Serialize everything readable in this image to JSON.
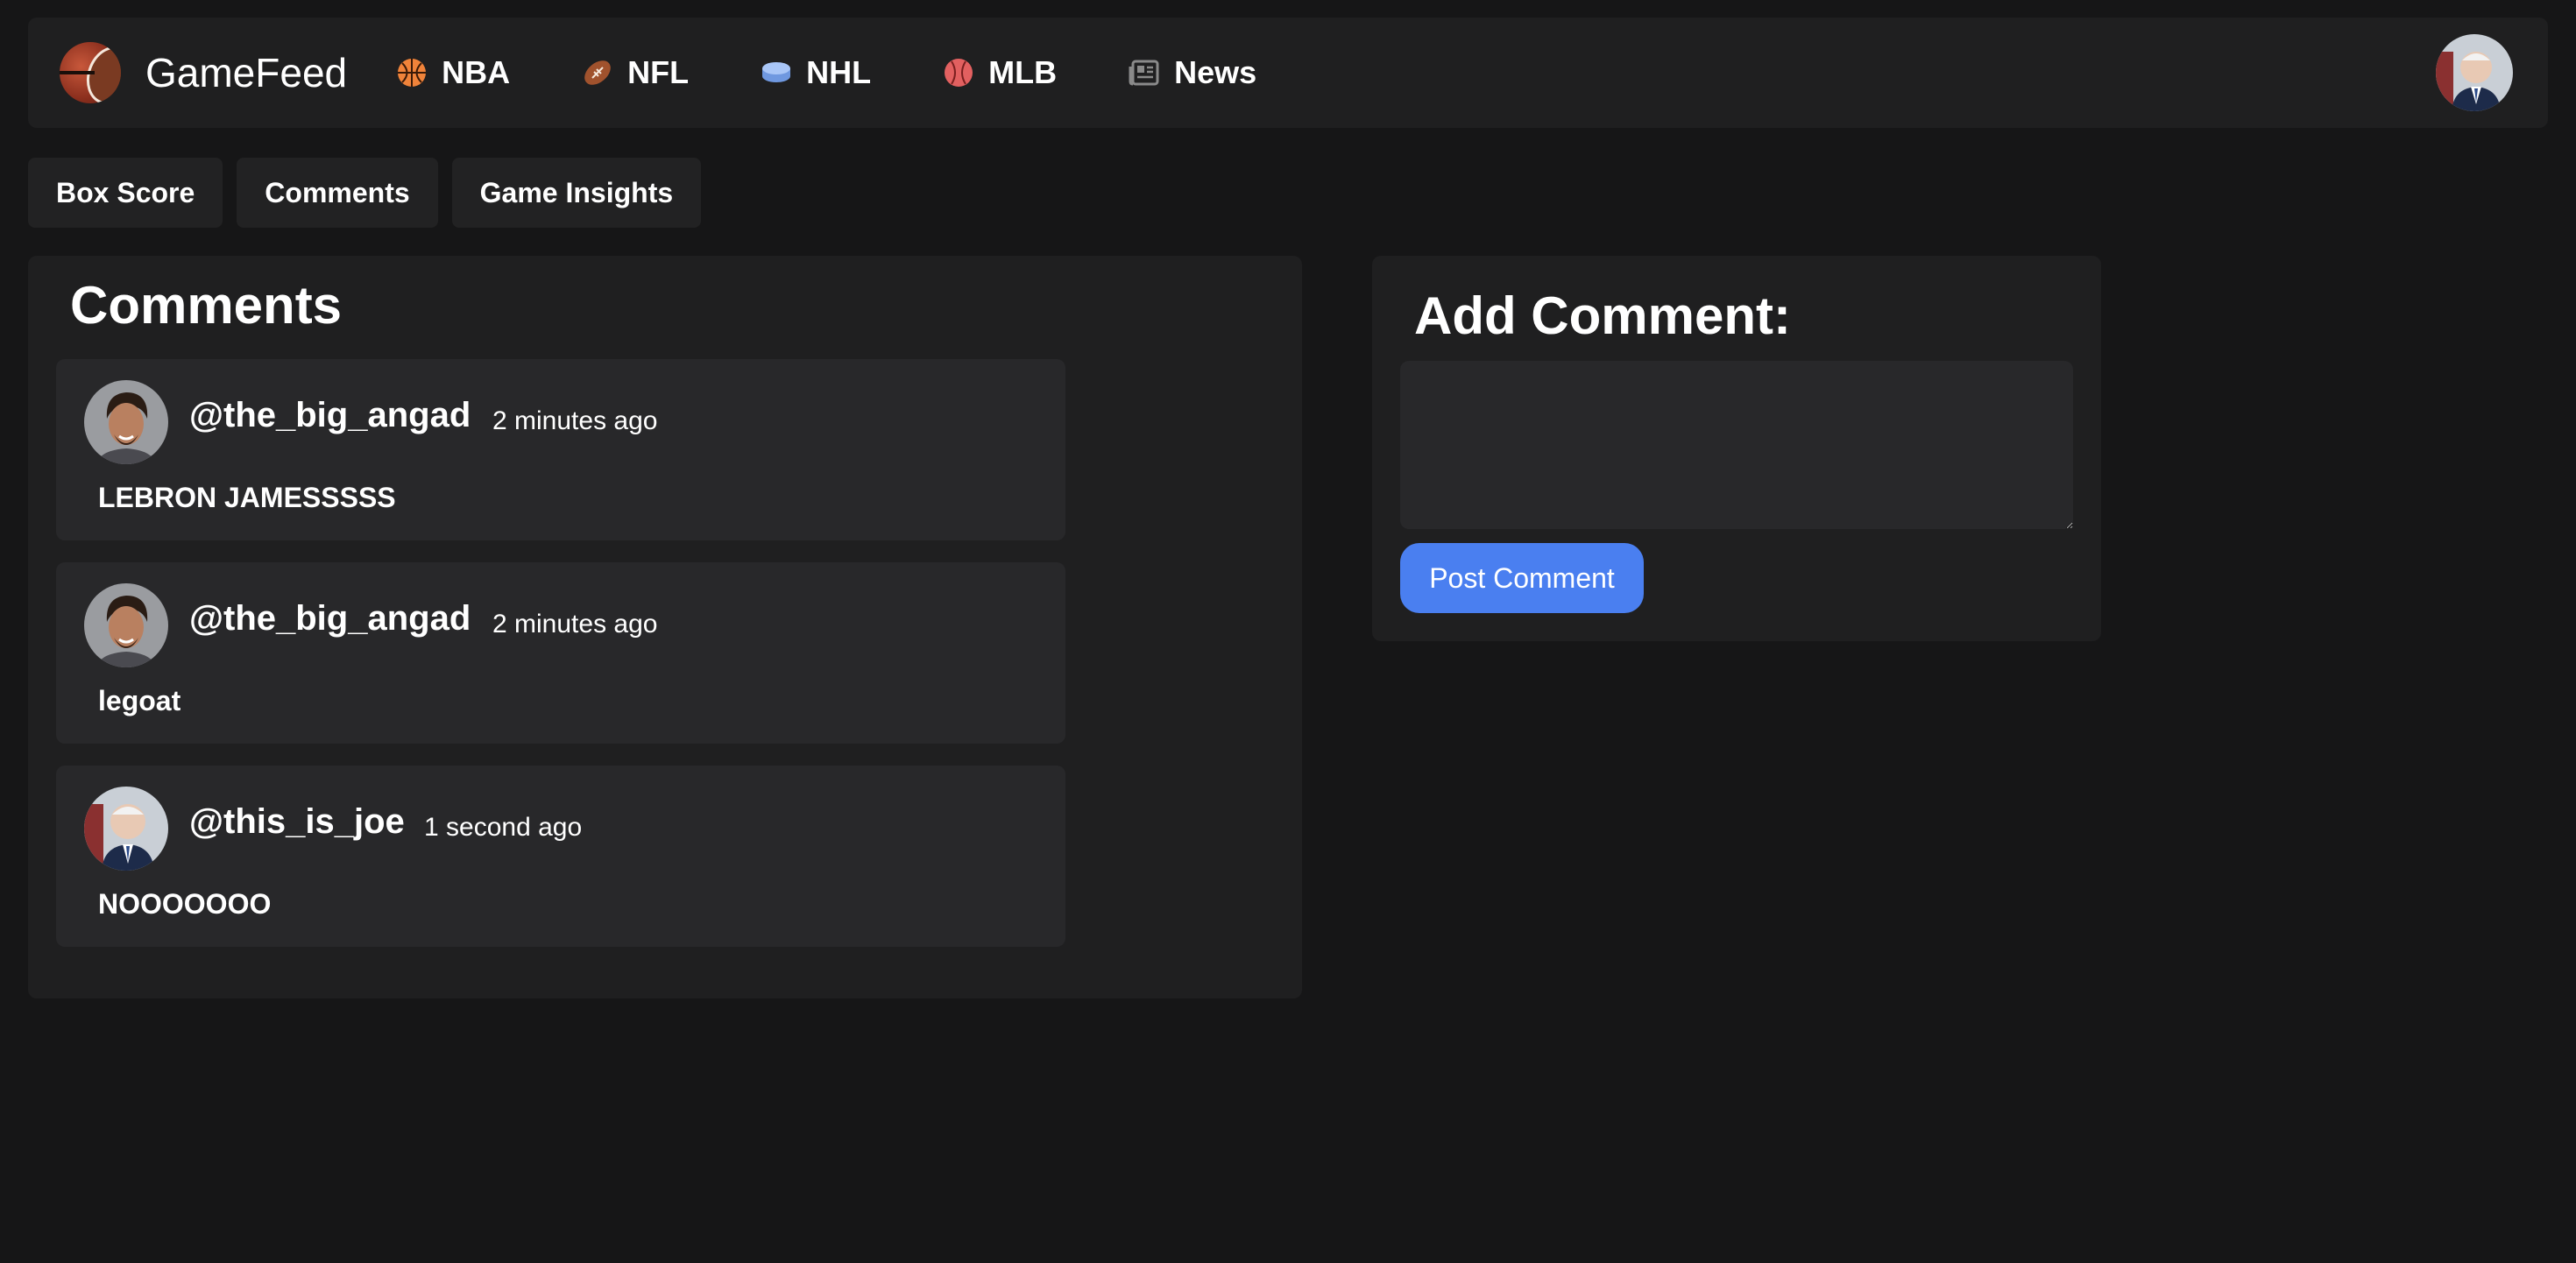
{
  "app": {
    "brand": "GameFeed"
  },
  "nav": {
    "items": [
      {
        "label": "NBA",
        "icon": "basketball-icon",
        "color": "#f0833a"
      },
      {
        "label": "NFL",
        "icon": "football-icon",
        "color": "#a0522d"
      },
      {
        "label": "NHL",
        "icon": "hockey-puck-icon",
        "color": "#8fb4f5"
      },
      {
        "label": "MLB",
        "icon": "baseball-icon",
        "color": "#e26060"
      },
      {
        "label": "News",
        "icon": "newspaper-icon",
        "color": "#8a8a8a"
      }
    ]
  },
  "tabs": [
    "Box Score",
    "Comments",
    "Game Insights"
  ],
  "comments": {
    "title": "Comments",
    "items": [
      {
        "username": "@the_big_angad",
        "time": "2 minutes ago",
        "text": "LEBRON JAMESSSSS"
      },
      {
        "username": "@the_big_angad",
        "time": "2 minutes ago",
        "text": "legoat"
      },
      {
        "username": "@this_is_joe",
        "time": "1 second ago",
        "text": "NOOOOOOO"
      }
    ]
  },
  "add_comment": {
    "title": "Add Comment:",
    "textarea_value": "",
    "post_label": "Post Comment"
  },
  "colors": {
    "background": "#161617",
    "panel": "#1f1f20",
    "card": "#28282a",
    "accent": "#4a7ff0"
  }
}
